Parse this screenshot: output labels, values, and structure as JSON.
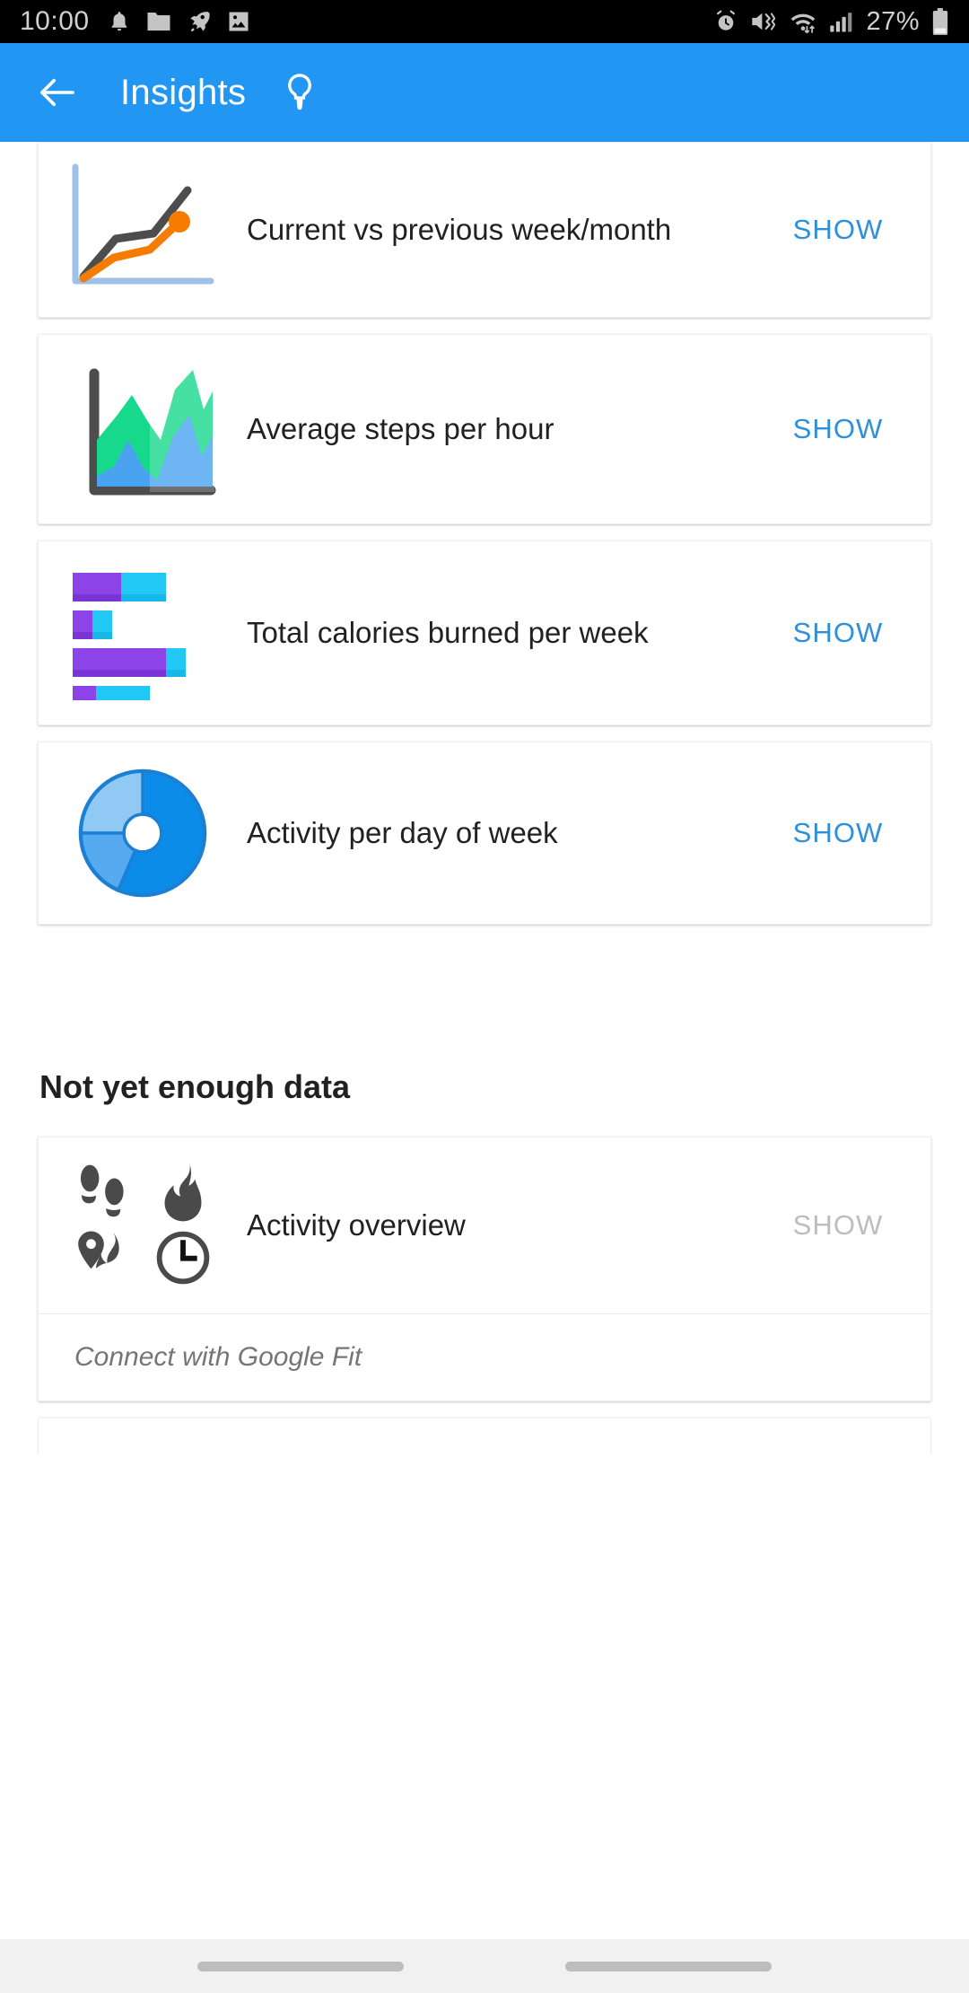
{
  "status_bar": {
    "time": "10:00",
    "battery_percent": "27%",
    "left_icons": [
      "bell-icon",
      "folder-icon",
      "rocket-icon",
      "image-icon"
    ],
    "right_icons": [
      "alarm-icon",
      "vibrate-icon",
      "wifi-icon",
      "signal-icon",
      "battery-icon"
    ]
  },
  "app_bar": {
    "title": "Insights",
    "back_icon": "back-arrow-icon",
    "accent_icon": "lightbulb-icon",
    "background_color": "#2196f3"
  },
  "theme": {
    "accent": "#2196f3",
    "action_link": "#2d8fdd",
    "action_disabled": "#bdbdbd",
    "text_primary": "#212121",
    "text_secondary": "#757575"
  },
  "insights": {
    "cards": [
      {
        "icon": "line-chart-icon",
        "label": "Current vs previous week/month",
        "action_label": "SHOW",
        "enabled": true
      },
      {
        "icon": "area-chart-icon",
        "label": "Average steps per hour",
        "action_label": "SHOW",
        "enabled": true
      },
      {
        "icon": "stacked-bar-chart-icon",
        "label": "Total calories burned per week",
        "action_label": "SHOW",
        "enabled": true
      },
      {
        "icon": "donut-chart-icon",
        "label": "Activity per day of week",
        "action_label": "SHOW",
        "enabled": true
      }
    ]
  },
  "not_enough_data": {
    "heading": "Not yet enough data",
    "card": {
      "icons": [
        "footsteps-icon",
        "flame-icon",
        "location-pin-icon",
        "clock-icon"
      ],
      "label": "Activity overview",
      "action_label": "SHOW",
      "enabled": false,
      "footer_note": "Connect with Google Fit"
    }
  },
  "chart_data": {
    "line_chart_icon": {
      "type": "line",
      "series": [
        {
          "name": "current",
          "color": "#4d4d4d",
          "points": [
            [
              0,
              5
            ],
            [
              22,
              42
            ],
            [
              38,
              45
            ],
            [
              52,
              78
            ]
          ]
        },
        {
          "name": "previous",
          "color": "#f57c00",
          "points": [
            [
              0,
              4
            ],
            [
              22,
              26
            ],
            [
              38,
              32
            ],
            [
              55,
              52
            ]
          ]
        }
      ],
      "axis_color": "#9fc0e8"
    },
    "area_chart_icon": {
      "type": "area",
      "series": [
        {
          "name": "upper",
          "color": "#17d98b"
        },
        {
          "name": "lower",
          "color": "#4aa3f0"
        }
      ],
      "axis_color": "#4d4d4d"
    },
    "stacked_bar_chart_icon": {
      "type": "bar",
      "orientation": "horizontal",
      "series": [
        {
          "name": "purple",
          "color": "#8c43e8",
          "values": [
            44,
            18,
            76,
            22
          ]
        },
        {
          "name": "cyan",
          "color": "#22c8f5",
          "values": [
            40,
            17,
            13,
            45
          ]
        }
      ]
    },
    "donut_chart_icon": {
      "type": "pie",
      "values": [
        50,
        27,
        23
      ],
      "colors": [
        "#0c8ce9",
        "#90c9f4",
        "#56aaef"
      ],
      "inner_radius_pct": 27
    }
  },
  "nav_bar": {
    "pills": 2
  }
}
